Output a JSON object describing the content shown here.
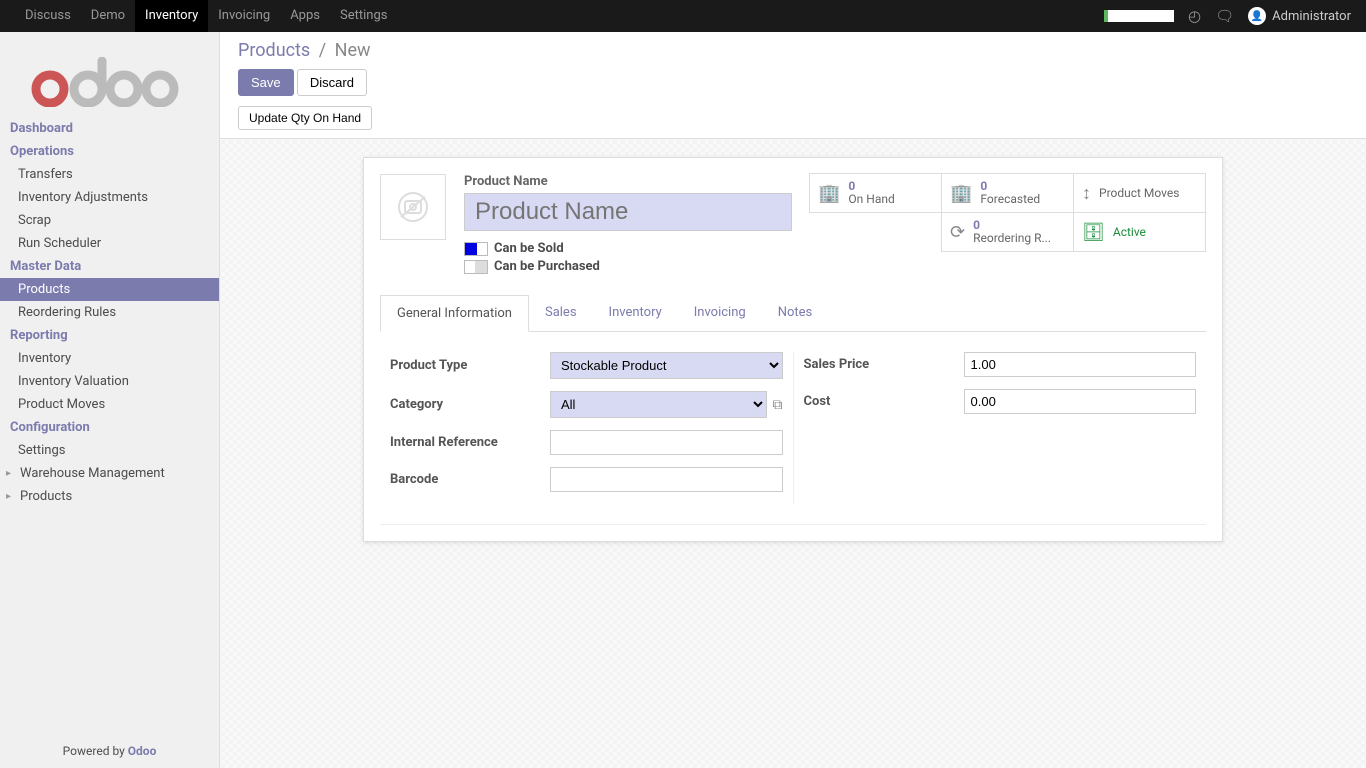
{
  "nav": {
    "items": [
      "Discuss",
      "Demo",
      "Inventory",
      "Invoicing",
      "Apps",
      "Settings"
    ],
    "active_index": 2,
    "user": "Administrator"
  },
  "sidebar": {
    "sections": [
      {
        "title": "Dashboard",
        "items": []
      },
      {
        "title": "Operations",
        "items": [
          "Transfers",
          "Inventory Adjustments",
          "Scrap",
          "Run Scheduler"
        ]
      },
      {
        "title": "Master Data",
        "items": [
          "Products",
          "Reordering Rules"
        ],
        "active": "Products"
      },
      {
        "title": "Reporting",
        "items": [
          "Inventory",
          "Inventory Valuation",
          "Product Moves"
        ]
      },
      {
        "title": "Configuration",
        "items": [
          "Settings",
          "Warehouse Management",
          "Products"
        ],
        "expandable": [
          false,
          true,
          true
        ]
      }
    ],
    "footer_prefix": "Powered by ",
    "footer_link": "Odoo"
  },
  "breadcrumb": {
    "root": "Products",
    "sep": "/",
    "current": "New"
  },
  "buttons": {
    "save": "Save",
    "discard": "Discard",
    "update_qty": "Update Qty On Hand"
  },
  "product": {
    "name_label": "Product Name",
    "name_placeholder": "Product Name",
    "can_be_sold_label": "Can be Sold",
    "can_be_sold": true,
    "can_be_purchased_label": "Can be Purchased",
    "can_be_purchased": false
  },
  "stats": [
    {
      "num": "0",
      "label": "On Hand",
      "icon": "building"
    },
    {
      "num": "0",
      "label": "Forecasted",
      "icon": "building"
    },
    {
      "num": "",
      "label": "Product Moves",
      "icon": "arrows-v"
    },
    {
      "num": "0",
      "label": "Reordering R...",
      "icon": "refresh"
    },
    {
      "num": "",
      "label": "Active",
      "icon": "archive",
      "green": true
    }
  ],
  "tabs": [
    "General Information",
    "Sales",
    "Inventory",
    "Invoicing",
    "Notes"
  ],
  "active_tab": 0,
  "form": {
    "left": [
      {
        "label": "Product Type",
        "type": "select",
        "value": "Stockable Product"
      },
      {
        "label": "Category",
        "type": "select_ext",
        "value": "All"
      },
      {
        "label": "Internal Reference",
        "type": "text",
        "value": ""
      },
      {
        "label": "Barcode",
        "type": "text",
        "value": ""
      }
    ],
    "right": [
      {
        "label": "Sales Price",
        "type": "text",
        "value": "1.00"
      },
      {
        "label": "Cost",
        "type": "text",
        "value": "0.00"
      }
    ]
  }
}
